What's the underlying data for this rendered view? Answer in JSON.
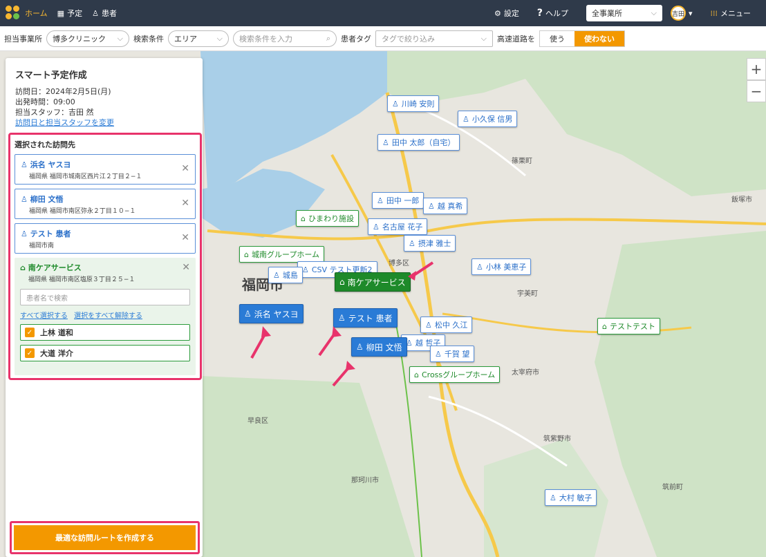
{
  "topbar": {
    "nav_home": "ホーム",
    "nav_schedule": "予定",
    "nav_patient": "患者",
    "settings": "設定",
    "help": "ヘルプ",
    "office_select": "全事業所",
    "avatar": "吉田",
    "menu": "メニュー"
  },
  "filters": {
    "office_label": "担当事業所",
    "office_value": "博多クリニック",
    "search_label": "検索条件",
    "search_type": "エリア",
    "search_placeholder": "検索条件を入力",
    "tag_label": "患者タグ",
    "tag_placeholder": "タグで絞り込み",
    "highway_label": "高速道路を",
    "highway_use": "使う",
    "highway_nouse": "使わない"
  },
  "sidebar": {
    "title": "スマート予定作成",
    "visit_date": "訪問日：2024年2月5日(月)",
    "depart_time": "出発時間：09:00",
    "staff": "担当スタッフ：吉田 然",
    "change_link": "訪問日と担当スタッフを変更",
    "selected_title": "選択された訪問先",
    "patients": [
      {
        "name": "浜名 ヤスヨ",
        "address": "福岡県 福岡市城南区西片江２丁目２−１"
      },
      {
        "name": "柳田 文悟",
        "address": "福岡県 福岡市南区弥永２丁目１０−１"
      },
      {
        "name": "テスト 患者",
        "address": "福岡市南"
      }
    ],
    "facility": {
      "name": "南ケアサービス",
      "address": "福岡県 福岡市南区塩原３丁目２５−１",
      "search_placeholder": "患者名で検索",
      "select_all": "すべて選択する",
      "deselect_all": "選択をすべて解除する",
      "residents": [
        "上林 道和",
        "大道 洋介"
      ]
    },
    "cta": "最適な訪問ルートを作成する"
  },
  "map": {
    "markers": [
      {
        "kind": "p",
        "name": "川崎 安則"
      },
      {
        "kind": "p",
        "name": "小久保 信男"
      },
      {
        "kind": "p",
        "name": "田中 太郎（自宅）"
      },
      {
        "kind": "p",
        "name": "田中 一郎"
      },
      {
        "kind": "p",
        "name": "越 真希"
      },
      {
        "kind": "f",
        "name": "ひまわり施設"
      },
      {
        "kind": "p",
        "name": "名古屋 花子"
      },
      {
        "kind": "p",
        "name": "摂津 雅士"
      },
      {
        "kind": "f",
        "name": "城南グループホーム"
      },
      {
        "kind": "p",
        "name": "CSV テスト更新2"
      },
      {
        "kind": "p",
        "name": "城島"
      },
      {
        "kind": "p",
        "name": "小林 美恵子"
      },
      {
        "kind": "p",
        "name": "松中 久江"
      },
      {
        "kind": "p",
        "name": "越 哲子"
      },
      {
        "kind": "p",
        "name": "千賀 望"
      },
      {
        "kind": "f",
        "name": "Crossグループホーム"
      },
      {
        "kind": "f",
        "name": "テストテスト"
      },
      {
        "kind": "p",
        "name": "大村 敏子"
      }
    ],
    "selected": [
      {
        "kind": "sel",
        "name": "浜名 ヤスヨ"
      },
      {
        "kind": "sel",
        "name": "テスト 患者"
      },
      {
        "kind": "sel",
        "name": "柳田 文悟"
      },
      {
        "kind": "selg",
        "name": "南ケアサービス"
      }
    ],
    "labels": {
      "fukuoka": "福岡市",
      "hakata": "博多区",
      "dazaifu": "太宰府市",
      "nakagawa": "那珂川市",
      "chikushino": "筑紫野市",
      "kasuya": "篠栗町",
      "iizuka": "飯塚市",
      "umi": "宇美町",
      "sawara": "早良区",
      "chikuzen": "筑前町"
    }
  },
  "colors": {
    "accent": "#f39800",
    "highlight": "#e8336b",
    "patient": "#2a7bd6",
    "facility": "#1e8a2a"
  }
}
